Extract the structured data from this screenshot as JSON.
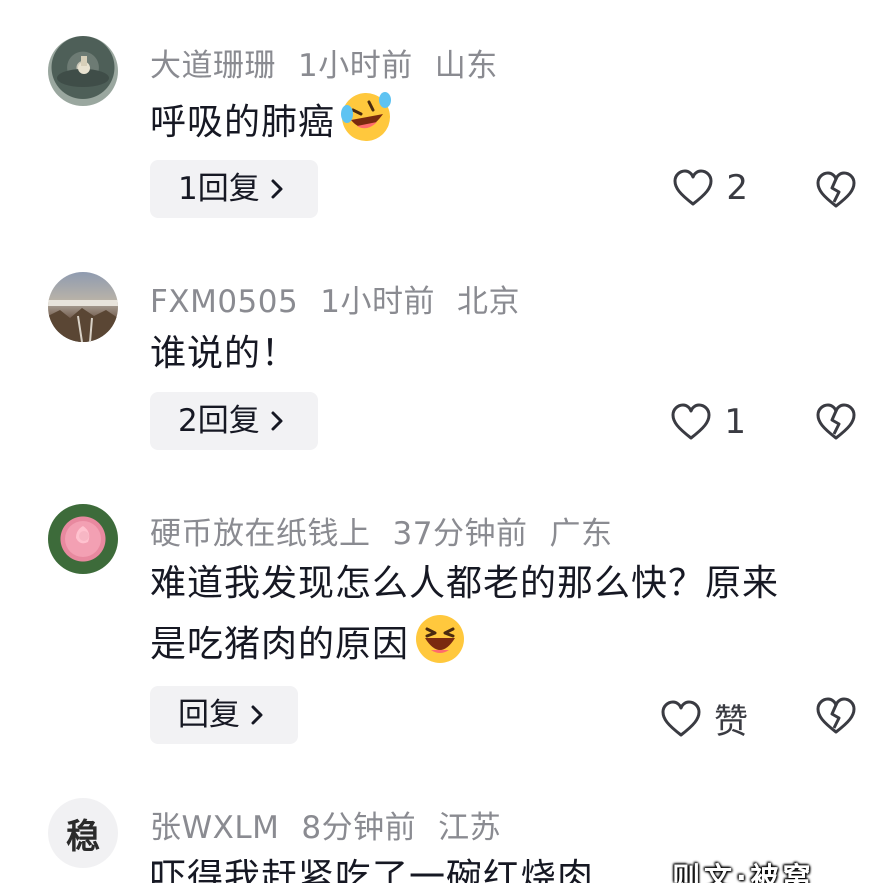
{
  "comments": [
    {
      "username": "大道珊珊",
      "time": "1小时前",
      "location": "山东",
      "text_lines": [
        "呼吸的肺癌"
      ],
      "emoji": "laughing-crying-emoji",
      "reply_label": "1回复",
      "like_count": "2"
    },
    {
      "username": "FXM0505",
      "time": "1小时前",
      "location": "北京",
      "text_lines": [
        "谁说的！"
      ],
      "emoji": "",
      "reply_label": "2回复",
      "like_count": "1"
    },
    {
      "username": "硬币放在纸钱上",
      "time": "37分钟前",
      "location": "广东",
      "text_lines": [
        "难道我发现怎么人都老的那么快？原来",
        "是吃猪肉的原因"
      ],
      "emoji": "grinning-emoji",
      "reply_label": "回复",
      "like_count": "赞"
    },
    {
      "username": "张WXLM",
      "time": "8分钟前",
      "location": "江苏",
      "avatar_text": "稳",
      "text_lines": [
        "吓得我赶紧吃了一碗红烧肉"
      ],
      "emoji": "",
      "reply_label": "",
      "like_count": ""
    }
  ],
  "watermark": "则文·被窝",
  "colors": {
    "meta_gray": "#8a8b91",
    "reply_bg": "#f2f2f4",
    "text": "#161823"
  }
}
